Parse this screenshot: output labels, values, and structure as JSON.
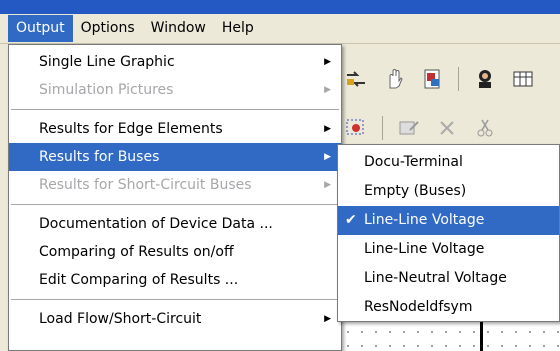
{
  "menubar": {
    "items": [
      {
        "label": "Output",
        "active": true
      },
      {
        "label": "Options"
      },
      {
        "label": "Window"
      },
      {
        "label": "Help"
      }
    ]
  },
  "output_menu": {
    "items": [
      {
        "label": "Single Line Graphic",
        "submenu": true
      },
      {
        "label": "Simulation Pictures",
        "submenu": true,
        "disabled": true
      },
      {
        "label": "Results for Edge Elements",
        "submenu": true
      },
      {
        "label": "Results for Buses",
        "submenu": true,
        "selected": true
      },
      {
        "label": "Results for Short-Circuit Buses",
        "submenu": true,
        "disabled": true
      },
      {
        "label": "Documentation of Device Data ..."
      },
      {
        "label": "Comparing of Results on/off"
      },
      {
        "label": "Edit Comparing of Results ..."
      },
      {
        "label": "Load Flow/Short-Circuit",
        "submenu": true
      }
    ]
  },
  "buses_submenu": {
    "items": [
      {
        "label": "Docu-Terminal"
      },
      {
        "label": "Empty (Buses)"
      },
      {
        "label": "Line-Line Voltage",
        "checked": true,
        "selected": true
      },
      {
        "label": "Line-Line Voltage"
      },
      {
        "label": "Line-Neutral Voltage"
      },
      {
        "label": "ResNodeldfsym"
      }
    ]
  },
  "icons": {
    "submenu_arrow": "▶",
    "check": "✔"
  },
  "colors": {
    "highlight": "#316ac5",
    "disabled_text": "#a7a6aa",
    "title_bar": "#2459c4",
    "face": "#ece9d8"
  }
}
